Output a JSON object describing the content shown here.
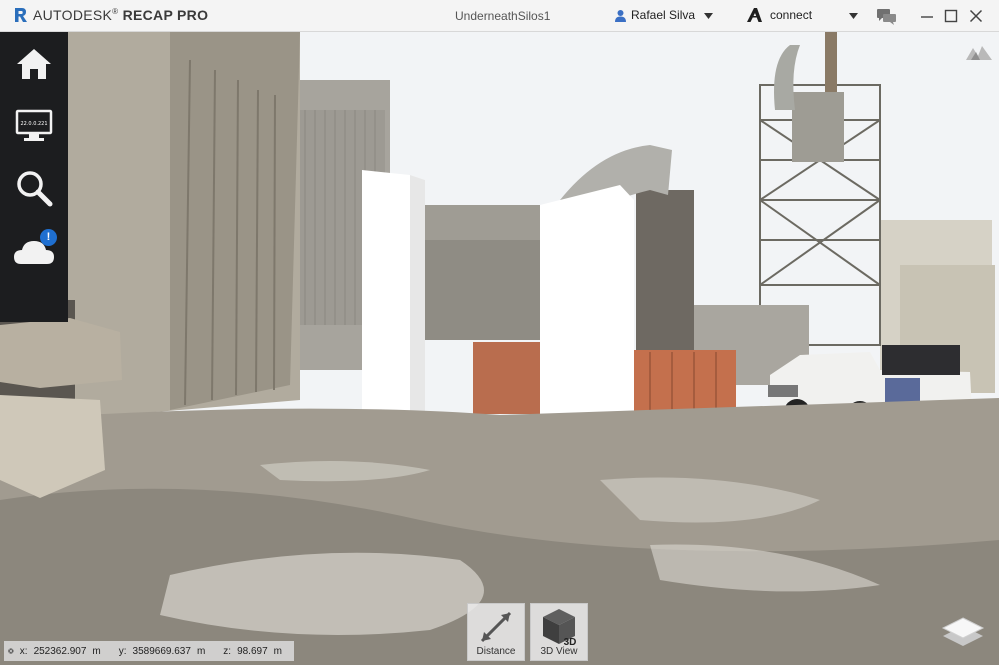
{
  "app": {
    "brand": "AUTODESK",
    "product": "RECAP PRO",
    "document_title": "UnderneathSilos1"
  },
  "user": {
    "name": "Rafael Silva"
  },
  "hub": {
    "name": "connect"
  },
  "sidebar": {
    "ip_label": "22.0.0.221",
    "cloud_badge": "!"
  },
  "tools": [
    {
      "label": "Distance",
      "icon": "ruler-diagonal-icon"
    },
    {
      "label": "3D View",
      "icon": "cube-3d-icon",
      "icon_text": "3D"
    }
  ],
  "coordinates": {
    "x_label": "x:",
    "x": "252362.907",
    "x_unit": "m",
    "y_label": "y:",
    "y": "3589669.637",
    "y_unit": "m",
    "z_label": "z:",
    "z": "98.697",
    "z_unit": "m"
  },
  "colors": {
    "accent": "#1f6fd0",
    "sidebar": "#1c1d1f",
    "titlebar": "#f4f4f4"
  }
}
